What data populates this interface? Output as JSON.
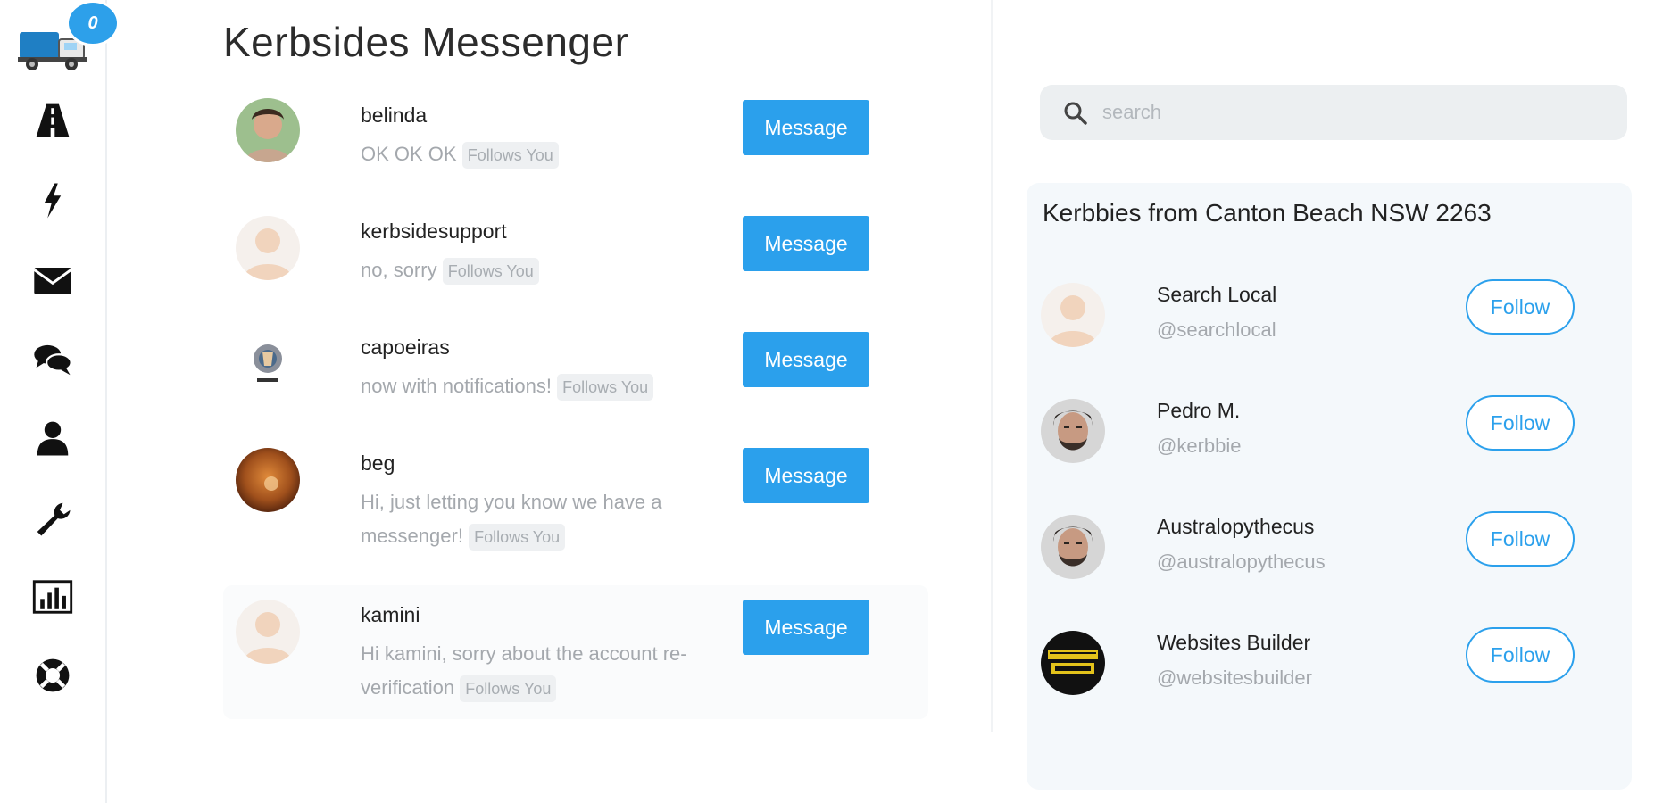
{
  "app": {
    "title": "Kerbsides Messenger",
    "notification_count": "0",
    "brand_color": "#2ba0ec"
  },
  "nav": {
    "items": [
      {
        "icon": "road-icon"
      },
      {
        "icon": "lightning-icon"
      },
      {
        "icon": "envelope-icon"
      },
      {
        "icon": "chat-bubbles-icon"
      },
      {
        "icon": "user-icon"
      },
      {
        "icon": "wrench-icon"
      },
      {
        "icon": "bar-chart-icon"
      },
      {
        "icon": "lifebuoy-icon"
      }
    ]
  },
  "conversations": [
    {
      "name": "belinda",
      "text": "OK OK OK",
      "tag": "Follows You",
      "button": "Message"
    },
    {
      "name": "kerbsidesupport",
      "text": "no, sorry",
      "tag": "Follows You",
      "button": "Message"
    },
    {
      "name": "capoeiras",
      "text": "now with notifications!",
      "tag": "Follows You",
      "button": "Message"
    },
    {
      "name": "beg",
      "text": "Hi, just letting you know we have a messenger!",
      "tag": "Follows You",
      "button": "Message"
    },
    {
      "name": "kamini",
      "text": "Hi kamini, sorry about the account re-verification",
      "tag": "Follows You",
      "button": "Message"
    }
  ],
  "search": {
    "placeholder": "search"
  },
  "suggestions": {
    "title": "Kerbbies from Canton Beach NSW 2263",
    "items": [
      {
        "name": "Search Local",
        "handle": "@searchlocal",
        "button": "Follow"
      },
      {
        "name": "Pedro M.",
        "handle": "@kerbbie",
        "button": "Follow"
      },
      {
        "name": "Australopythecus",
        "handle": "@australopythecus",
        "button": "Follow"
      },
      {
        "name": "Websites Builder",
        "handle": "@websitesbuilder",
        "button": "Follow"
      }
    ]
  }
}
